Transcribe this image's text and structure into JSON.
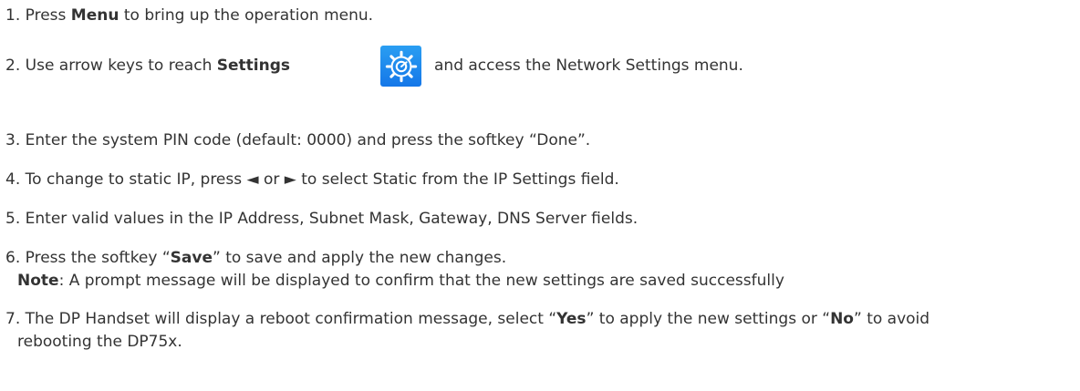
{
  "steps": [
    {
      "num": "1.",
      "pre": "Press ",
      "bold": "Menu",
      "post": " to bring up the operation menu."
    },
    {
      "num": "2.",
      "pre": "Use arrow keys to reach ",
      "bold": "Settings",
      "icon": "settings-gear-icon",
      "post": "and access the Network Settings menu."
    },
    {
      "num": "3.",
      "text": "Enter the system PIN code (default: 0000) and press the softkey “Done”."
    },
    {
      "num": "4.",
      "text": "To change to static IP, press ◄ or ► to select Static from the IP Settings field."
    },
    {
      "num": "5.",
      "text": "Enter valid values in the IP Address, Subnet Mask, Gateway, DNS Server fields."
    },
    {
      "num": "6.",
      "pre": "Press the softkey “",
      "bold": "Save",
      "post": "” to save and apply the new changes.",
      "note_label": "Note",
      "note_text": ": A prompt message will be displayed to confirm that the new settings are saved successfully"
    },
    {
      "num": "7.",
      "pre": "The DP Handset will display a reboot confirmation message, select “",
      "bold1": "Yes",
      "mid": "” to apply the new settings or “",
      "bold2": "No",
      "post": "” to avoid",
      "line2": "rebooting the DP75x."
    }
  ],
  "colors": {
    "text": "#333333",
    "icon_bg": "#1a86ec"
  }
}
